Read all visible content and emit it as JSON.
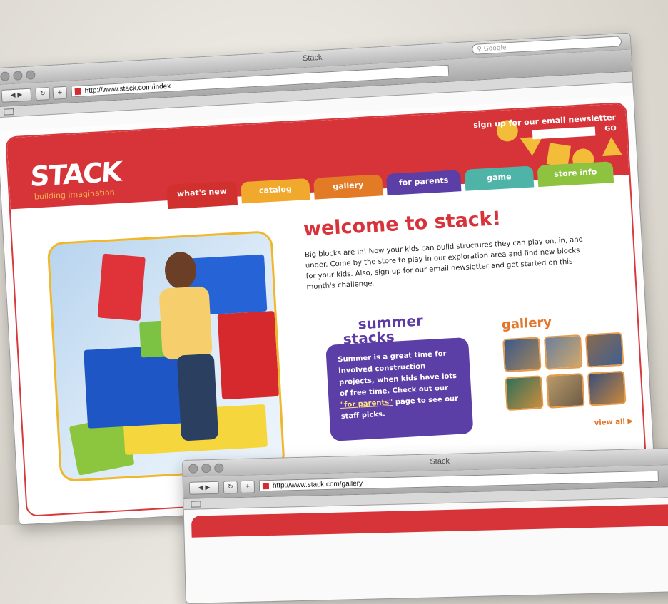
{
  "browser_main": {
    "window_title": "Stack",
    "search_placeholder": "Google",
    "url": "http://www.stack.com/index"
  },
  "browser_second": {
    "window_title": "Stack",
    "url": "http://www.stack.com/gallery"
  },
  "site": {
    "logo": "STACK",
    "tagline": "building imagination",
    "signup_label": "sign up for our email newsletter",
    "signup_go": "GO",
    "nav": [
      {
        "label": "what's new",
        "color": "#d0302e"
      },
      {
        "label": "catalog",
        "color": "#f0a92c"
      },
      {
        "label": "gallery",
        "color": "#e27a26"
      },
      {
        "label": "for parents",
        "color": "#5b3ea6"
      },
      {
        "label": "game",
        "color": "#4fb4a8"
      },
      {
        "label": "store info",
        "color": "#8ec340"
      }
    ],
    "welcome_title": "welcome to stack!",
    "welcome_text": "Big blocks are in! Now your kids can build structures they can play on, in, and under. Come by the store to play in our exploration area and find new blocks for your kids. Also, sign up for our email newsletter and get started on this month's challenge.",
    "summer_title_1": "summer",
    "summer_title_2": "stacks",
    "summer_text_1": "Summer is a great time for involved construction projects, when kids have lots of free time. Check out our ",
    "summer_link": "\"for parents\"",
    "summer_text_2": " page to see our staff picks.",
    "gallery_title": "gallery",
    "view_all": "view all ▶"
  },
  "colors": {
    "brand_red": "#d7343a",
    "accent_yellow": "#f3bd3a",
    "purple": "#5b3ea6",
    "orange": "#e2762a"
  }
}
